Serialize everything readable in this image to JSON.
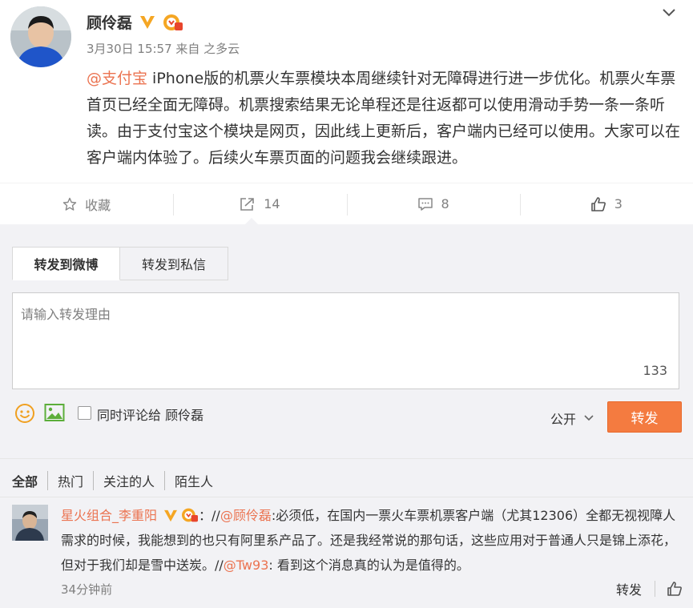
{
  "post": {
    "username": "顾伶磊",
    "meta": "3月30日 15:57 来自 之多云",
    "mention": "@支付宝",
    "body": " iPhone版的机票火车票模块本周继续针对无障碍进行进一步优化。机票火车票首页已经全面无障碍。机票搜索结果无论单程还是往返都可以使用滑动手势一条一条听读。由于支付宝这个模块是网页，因此线上更新后，客户端内已经可以使用。大家可以在客户端内体验了。后续火车票页面的问题我会继续跟进。"
  },
  "actions": [
    {
      "icon": "star-icon",
      "label": "收藏"
    },
    {
      "icon": "repost-icon",
      "label": "14"
    },
    {
      "icon": "comment-icon",
      "label": "8"
    },
    {
      "icon": "like-icon",
      "label": "3"
    }
  ],
  "repost": {
    "tabs": [
      "转发到微博",
      "转发到私信"
    ],
    "placeholder": "请输入转发理由",
    "counter": "133",
    "checkbox_label": "同时评论给 顾伶磊",
    "visibility": "公开",
    "submit": "转发"
  },
  "filters": [
    "全部",
    "热门",
    "关注的人",
    "陌生人"
  ],
  "comment": {
    "username": "星火组合_李重阳",
    "text_1": "：//",
    "mention_1": "@顾伶磊",
    "text_2": ":必须低，在国内一票火车票机票客户端（尤其12306）全都无视视障人需求的时候，我能想到的也只有阿里系产品了。还是我经常说的那句话，这些应用对于普通人只是锦上添花，但对于我们却是雪中送炭。//",
    "mention_2": "@Tw93",
    "text_3": ": 看到这个消息真的认为是值得的。",
    "time": "34分钟前",
    "repost": "转发"
  },
  "colors": {
    "accent": "#eb7350",
    "submit": "#f47b40",
    "verified": "#f5a623",
    "panel_bg": "#f2f2f5"
  }
}
